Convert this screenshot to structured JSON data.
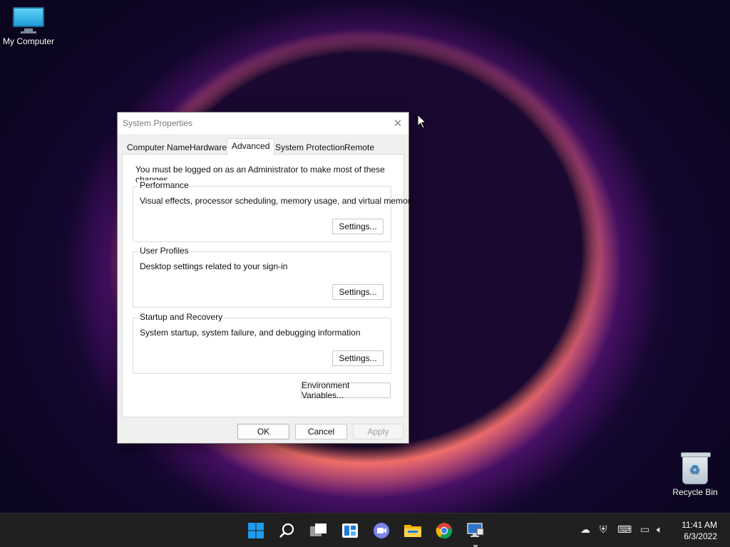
{
  "desktop": {
    "icons": [
      {
        "label": "My Computer",
        "icon": "monitor-icon"
      },
      {
        "label": "Recycle Bin",
        "icon": "recycle-bin-icon"
      }
    ]
  },
  "dialog": {
    "title": "System Properties",
    "close_icon": "close-icon",
    "tabs": [
      {
        "label": "Computer Name",
        "selected": false
      },
      {
        "label": "Hardware",
        "selected": false
      },
      {
        "label": "Advanced",
        "selected": true
      },
      {
        "label": "System Protection",
        "selected": false
      },
      {
        "label": "Remote",
        "selected": false
      }
    ],
    "admin_note": "You must be logged on as an Administrator to make most of these changes.",
    "groups": [
      {
        "title": "Performance",
        "description": "Visual effects, processor scheduling, memory usage, and virtual memory",
        "button": "Settings..."
      },
      {
        "title": "User Profiles",
        "description": "Desktop settings related to your sign-in",
        "button": "Settings..."
      },
      {
        "title": "Startup and Recovery",
        "description": "System startup, system failure, and debugging information",
        "button": "Settings..."
      }
    ],
    "env_button": "Environment Variables...",
    "ok_button": "OK",
    "cancel_button": "Cancel",
    "apply_button": "Apply",
    "apply_enabled": false
  },
  "taskbar": {
    "apps": [
      "start-icon",
      "search-icon",
      "task-view-icon",
      "widgets-icon",
      "chat-icon",
      "file-explorer-icon",
      "chrome-icon",
      "system-properties-icon"
    ],
    "tray": [
      "cloud-offline-icon",
      "security-warning-icon",
      "keyboard-icon",
      "network-icon",
      "volume-icon"
    ],
    "time": "11:41 AM",
    "date": "6/3/2022"
  },
  "colors": {
    "accent": "#0078d4",
    "taskbar": "#202020",
    "dialog_bg": "#f0f0f0"
  }
}
